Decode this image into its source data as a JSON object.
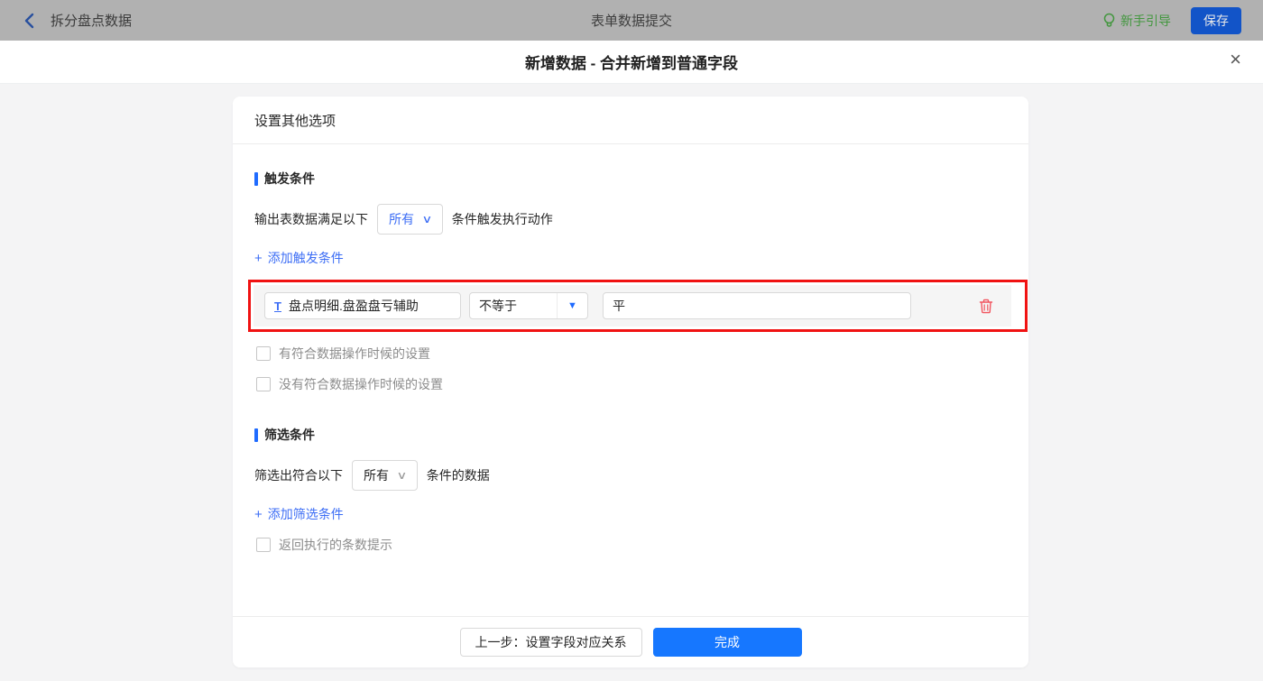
{
  "topbar": {
    "back_label": "拆分盘点数据",
    "title": "表单数据提交",
    "guide_label": "新手引导",
    "save_label": "保存"
  },
  "dialog": {
    "title": "新增数据 - 合并新增到普通字段"
  },
  "panel": {
    "header": "设置其他选项",
    "trigger_section": {
      "title": "触发条件",
      "sentence_prefix": "输出表数据满足以下",
      "match_select_value": "所有",
      "sentence_suffix": "条件触发执行动作",
      "add_link_label": "添加触发条件",
      "condition_row": {
        "field_value": "盘点明细.盘盈盘亏辅助",
        "operator_value": "不等于",
        "value_text": "平"
      },
      "checkboxes": [
        {
          "label": "有符合数据操作时候的设置",
          "checked": false
        },
        {
          "label": "没有符合数据操作时候的设置",
          "checked": false
        }
      ]
    },
    "filter_section": {
      "title": "筛选条件",
      "sentence_prefix": "筛选出符合以下",
      "match_select_value": "所有",
      "sentence_suffix": "条件的数据",
      "add_link_label": "添加筛选条件",
      "checkbox_label": "返回执行的条数提示"
    },
    "footer": {
      "prev_label": "上一步：设置字段对应关系",
      "done_label": "完成"
    }
  },
  "icons": {
    "plus": "+",
    "close": "×",
    "chevron_down": "∨",
    "caret_down": "▼",
    "text_field": "T"
  },
  "colors": {
    "accent_blue": "#1f6bff",
    "link_blue": "#3d6ef5",
    "save_button_blue": "#1254c8",
    "done_button_blue": "#1677ff",
    "guide_green": "#43973f",
    "highlight_red": "#f01212",
    "trash_red": "#f2555f",
    "topbar_gray": "#b1b1b1"
  }
}
